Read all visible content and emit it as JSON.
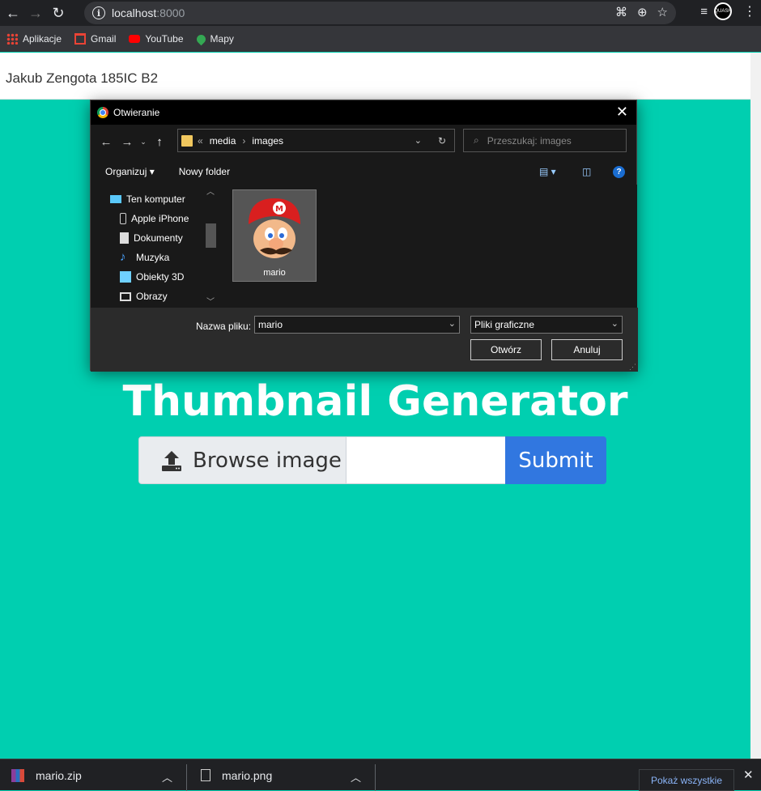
{
  "browser": {
    "url_host": "localhost",
    "url_port": ":8000",
    "bookmarks": [
      {
        "label": "Aplikacje",
        "icon": "apps-grid-icon"
      },
      {
        "label": "Gmail",
        "icon": "gmail-icon"
      },
      {
        "label": "YouTube",
        "icon": "youtube-icon"
      },
      {
        "label": "Mapy",
        "icon": "maps-icon"
      }
    ],
    "avatar_text": "QUASH"
  },
  "page": {
    "header_text": "Jakub Zengota 185IC B2",
    "title": "Thumbnail Generator",
    "browse_label": "Browse image",
    "submit_label": "Submit"
  },
  "dialog": {
    "title": "Otwieranie",
    "path_prefix": "«",
    "path": [
      "media",
      "images"
    ],
    "search_placeholder": "Przeszukaj: images",
    "organize_label": "Organizuj",
    "new_folder_label": "Nowy folder",
    "tree": [
      "Ten komputer",
      "Apple iPhone",
      "Dokumenty",
      "Muzyka",
      "Obiekty 3D",
      "Obrazy"
    ],
    "file_tile_label": "mario",
    "filename_label": "Nazwa pliku:",
    "filename_value": "mario",
    "filetype_value": "Pliki graficzne",
    "open_label": "Otwórz",
    "cancel_label": "Anuluj"
  },
  "downloads": {
    "items": [
      {
        "name": "mario.zip",
        "icon": "archive-icon"
      },
      {
        "name": "mario.png",
        "icon": "image-file-icon"
      }
    ],
    "show_all_label": "Pokaż wszystkie"
  }
}
